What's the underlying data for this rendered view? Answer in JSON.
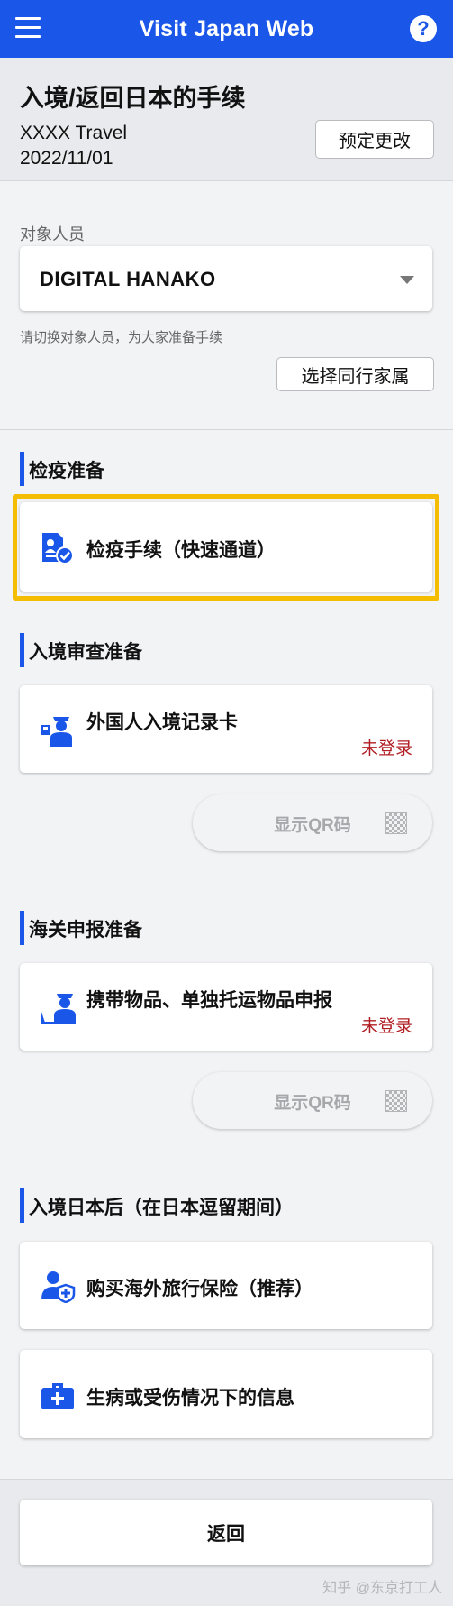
{
  "header": {
    "title": "Visit Japan Web",
    "menu_icon": "menu-icon",
    "help_label": "?"
  },
  "trip": {
    "page_title": "入境/返回日本的手续",
    "trip_name": "XXXX Travel",
    "date": "2022/11/01",
    "change_label": "预定更改"
  },
  "person": {
    "label": "对象人员",
    "selected": "DIGITAL HANAKO",
    "hint": "请切换对象人员，为大家准备手续",
    "family_button": "选择同行家属"
  },
  "sections": {
    "quarantine": {
      "title": "检疫准备",
      "card_label": "检疫手续（快速通道）",
      "icon": "quarantine-document-icon",
      "highlight_color": "#f5bd02"
    },
    "immigration": {
      "title": "入境审查准备",
      "card_label": "外国人入境记录卡",
      "status": "未登录",
      "qr_label": "显示QR码",
      "icon": "immigration-officer-icon"
    },
    "customs": {
      "title": "海关申报准备",
      "card_label": "携带物品、单独托运物品申报",
      "status": "未登录",
      "qr_label": "显示QR码",
      "icon": "customs-officer-icon"
    },
    "after_entry": {
      "title": "入境日本后（在日本逗留期间）",
      "insurance_label": "购买海外旅行保险（推荐）",
      "medical_label": "生病或受伤情况下的信息",
      "insurance_icon": "insurance-person-shield-icon",
      "medical_icon": "medical-kit-icon"
    }
  },
  "footer": {
    "back_label": "返回"
  },
  "watermark": "知乎 @东京打工人",
  "colors": {
    "brand": "#1a56e8",
    "status_red": "#b01e23",
    "highlight": "#f5bd02"
  }
}
